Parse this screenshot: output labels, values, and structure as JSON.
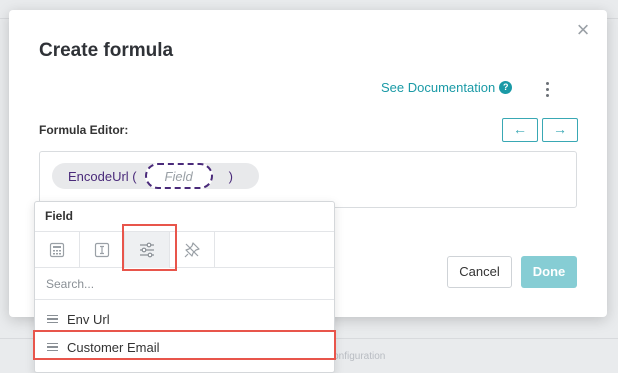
{
  "modal": {
    "title": "Create formula",
    "close_glyph": "×",
    "doc_link_label": "See Documentation",
    "help_glyph": "?",
    "editor_label": "Formula Editor:",
    "undo_glyph": "←",
    "redo_glyph": "→",
    "formula": {
      "function_name": "EncodeUrl (",
      "placeholder": "Field",
      "close_paren": ")"
    },
    "cancel_label": "Cancel",
    "done_label": "Done"
  },
  "dropdown": {
    "header": "Field",
    "tabs": [
      {
        "icon": "calculator-icon"
      },
      {
        "icon": "text-cursor-icon"
      },
      {
        "icon": "sliders-icon",
        "active": true
      },
      {
        "icon": "pin-off-icon"
      }
    ],
    "search_placeholder": "Search...",
    "items": [
      {
        "label": "Env Url"
      },
      {
        "label": "Customer Email"
      }
    ]
  },
  "background_text": "...base url, based on the instance configuration",
  "colors": {
    "accent": "#1a9aa6",
    "formula_text": "#4a2a7a",
    "highlight": "#e8554b",
    "done_disabled": "#86cdd4"
  }
}
